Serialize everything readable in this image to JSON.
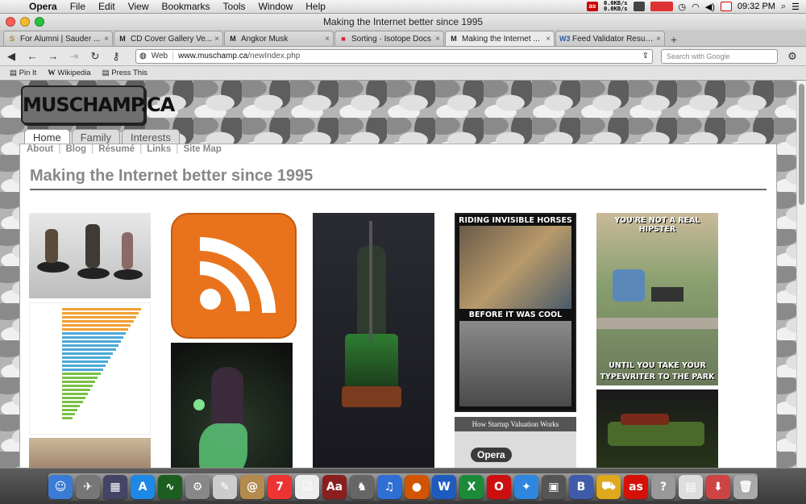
{
  "menubar": {
    "app": "Opera",
    "items": [
      "File",
      "Edit",
      "View",
      "Bookmarks",
      "Tools",
      "Window",
      "Help"
    ],
    "net_up": "0.0KB/s",
    "net_down": "0.0KB/s",
    "clock": "09:32 PM"
  },
  "window": {
    "title": "Making the Internet better since 1995"
  },
  "tabs": [
    {
      "label": "For Alumni | Sauder ...",
      "favicon": "sauder-icon",
      "color": "#a88a2c",
      "fav": "S"
    },
    {
      "label": "CD Cover Gallery Ve...",
      "favicon": "gothic-m-icon",
      "color": "#222",
      "fav": "M"
    },
    {
      "label": "Angkor Musk",
      "favicon": "gothic-m-icon",
      "color": "#222",
      "fav": "M"
    },
    {
      "label": "Sorting · Isotope Docs",
      "favicon": "isotope-icon",
      "color": "#d23",
      "fav": "■"
    },
    {
      "label": "Making the Internet ...",
      "favicon": "gothic-m-icon",
      "color": "#222",
      "fav": "M",
      "active": true
    },
    {
      "label": "Feed Validator Result...",
      "favicon": "w3c-icon",
      "color": "#2a5aa8",
      "fav": "W3"
    }
  ],
  "toolbar": {
    "web_label": "Web",
    "url_host": "www.muschamp.ca",
    "url_path": "/newIndex.php",
    "search_placeholder": "Search with Google"
  },
  "bookmarks": [
    "Pin It",
    "Wikipedia",
    "Press This"
  ],
  "site": {
    "logo": "MUSCHAMP.CA",
    "tabs": [
      "Home",
      "Family",
      "Interests"
    ],
    "subnav": [
      "About",
      "Blog",
      "Résumé",
      "Links",
      "Site Map"
    ],
    "title": "Making the Internet better since 1995",
    "meme1_top": "RIDING INVISIBLE HORSES",
    "meme1_bottom": "BEFORE IT WAS COOL",
    "meme2_top": "YOU'RE NOT A REAL HIPSTER",
    "meme2_bottom1": "UNTIL YOU TAKE YOUR",
    "meme2_bottom2": "TYPEWRITER TO THE PARK",
    "startup_caption": "How Startup Valuation Works"
  },
  "dock": {
    "tooltip": "Opera",
    "apps": [
      {
        "name": "finder-icon",
        "color": "#3a7bd5",
        "g": "☺"
      },
      {
        "name": "launchpad-icon",
        "color": "#777",
        "g": "✈"
      },
      {
        "name": "mission-control-icon",
        "color": "#446",
        "g": "▦"
      },
      {
        "name": "app-store-icon",
        "color": "#1e88e5",
        "g": "A"
      },
      {
        "name": "activity-monitor-icon",
        "color": "#1b5e20",
        "g": "∿"
      },
      {
        "name": "system-prefs-icon",
        "color": "#888",
        "g": "⚙"
      },
      {
        "name": "textedit-icon",
        "color": "#ccc",
        "g": "✎"
      },
      {
        "name": "contacts-icon",
        "color": "#b38b4d",
        "g": "@"
      },
      {
        "name": "calendar-icon",
        "color": "#e33",
        "g": "7"
      },
      {
        "name": "reminders-icon",
        "color": "#eee",
        "g": "☑"
      },
      {
        "name": "dictionary-icon",
        "color": "#8b1e1e",
        "g": "Aa"
      },
      {
        "name": "gimp-icon",
        "color": "#666",
        "g": "♞"
      },
      {
        "name": "itunes-icon",
        "color": "#2f6ed2",
        "g": "♫"
      },
      {
        "name": "firefox-icon",
        "color": "#d35400",
        "g": "●"
      },
      {
        "name": "word-icon",
        "color": "#1e5bbf",
        "g": "W"
      },
      {
        "name": "excel-icon",
        "color": "#1d8a3a",
        "g": "X"
      },
      {
        "name": "opera-icon",
        "color": "#cc1010",
        "g": "O"
      },
      {
        "name": "safari-icon",
        "color": "#2e86de",
        "g": "✦"
      },
      {
        "name": "preview-icon",
        "color": "#555",
        "g": "▣"
      },
      {
        "name": "bbedit-icon",
        "color": "#3f5ba9",
        "g": "B"
      },
      {
        "name": "transmit-icon",
        "color": "#e0a81c",
        "g": "⛟"
      },
      {
        "name": "lastfm-icon",
        "color": "#d51007",
        "g": "as"
      },
      {
        "name": "help-icon",
        "color": "#999",
        "g": "?"
      },
      {
        "name": "documents-icon",
        "color": "#ddd",
        "g": "▤"
      },
      {
        "name": "downloads-icon",
        "color": "#c44",
        "g": "⬇"
      },
      {
        "name": "trash-icon",
        "color": "#aaa",
        "g": "🗑"
      }
    ]
  }
}
